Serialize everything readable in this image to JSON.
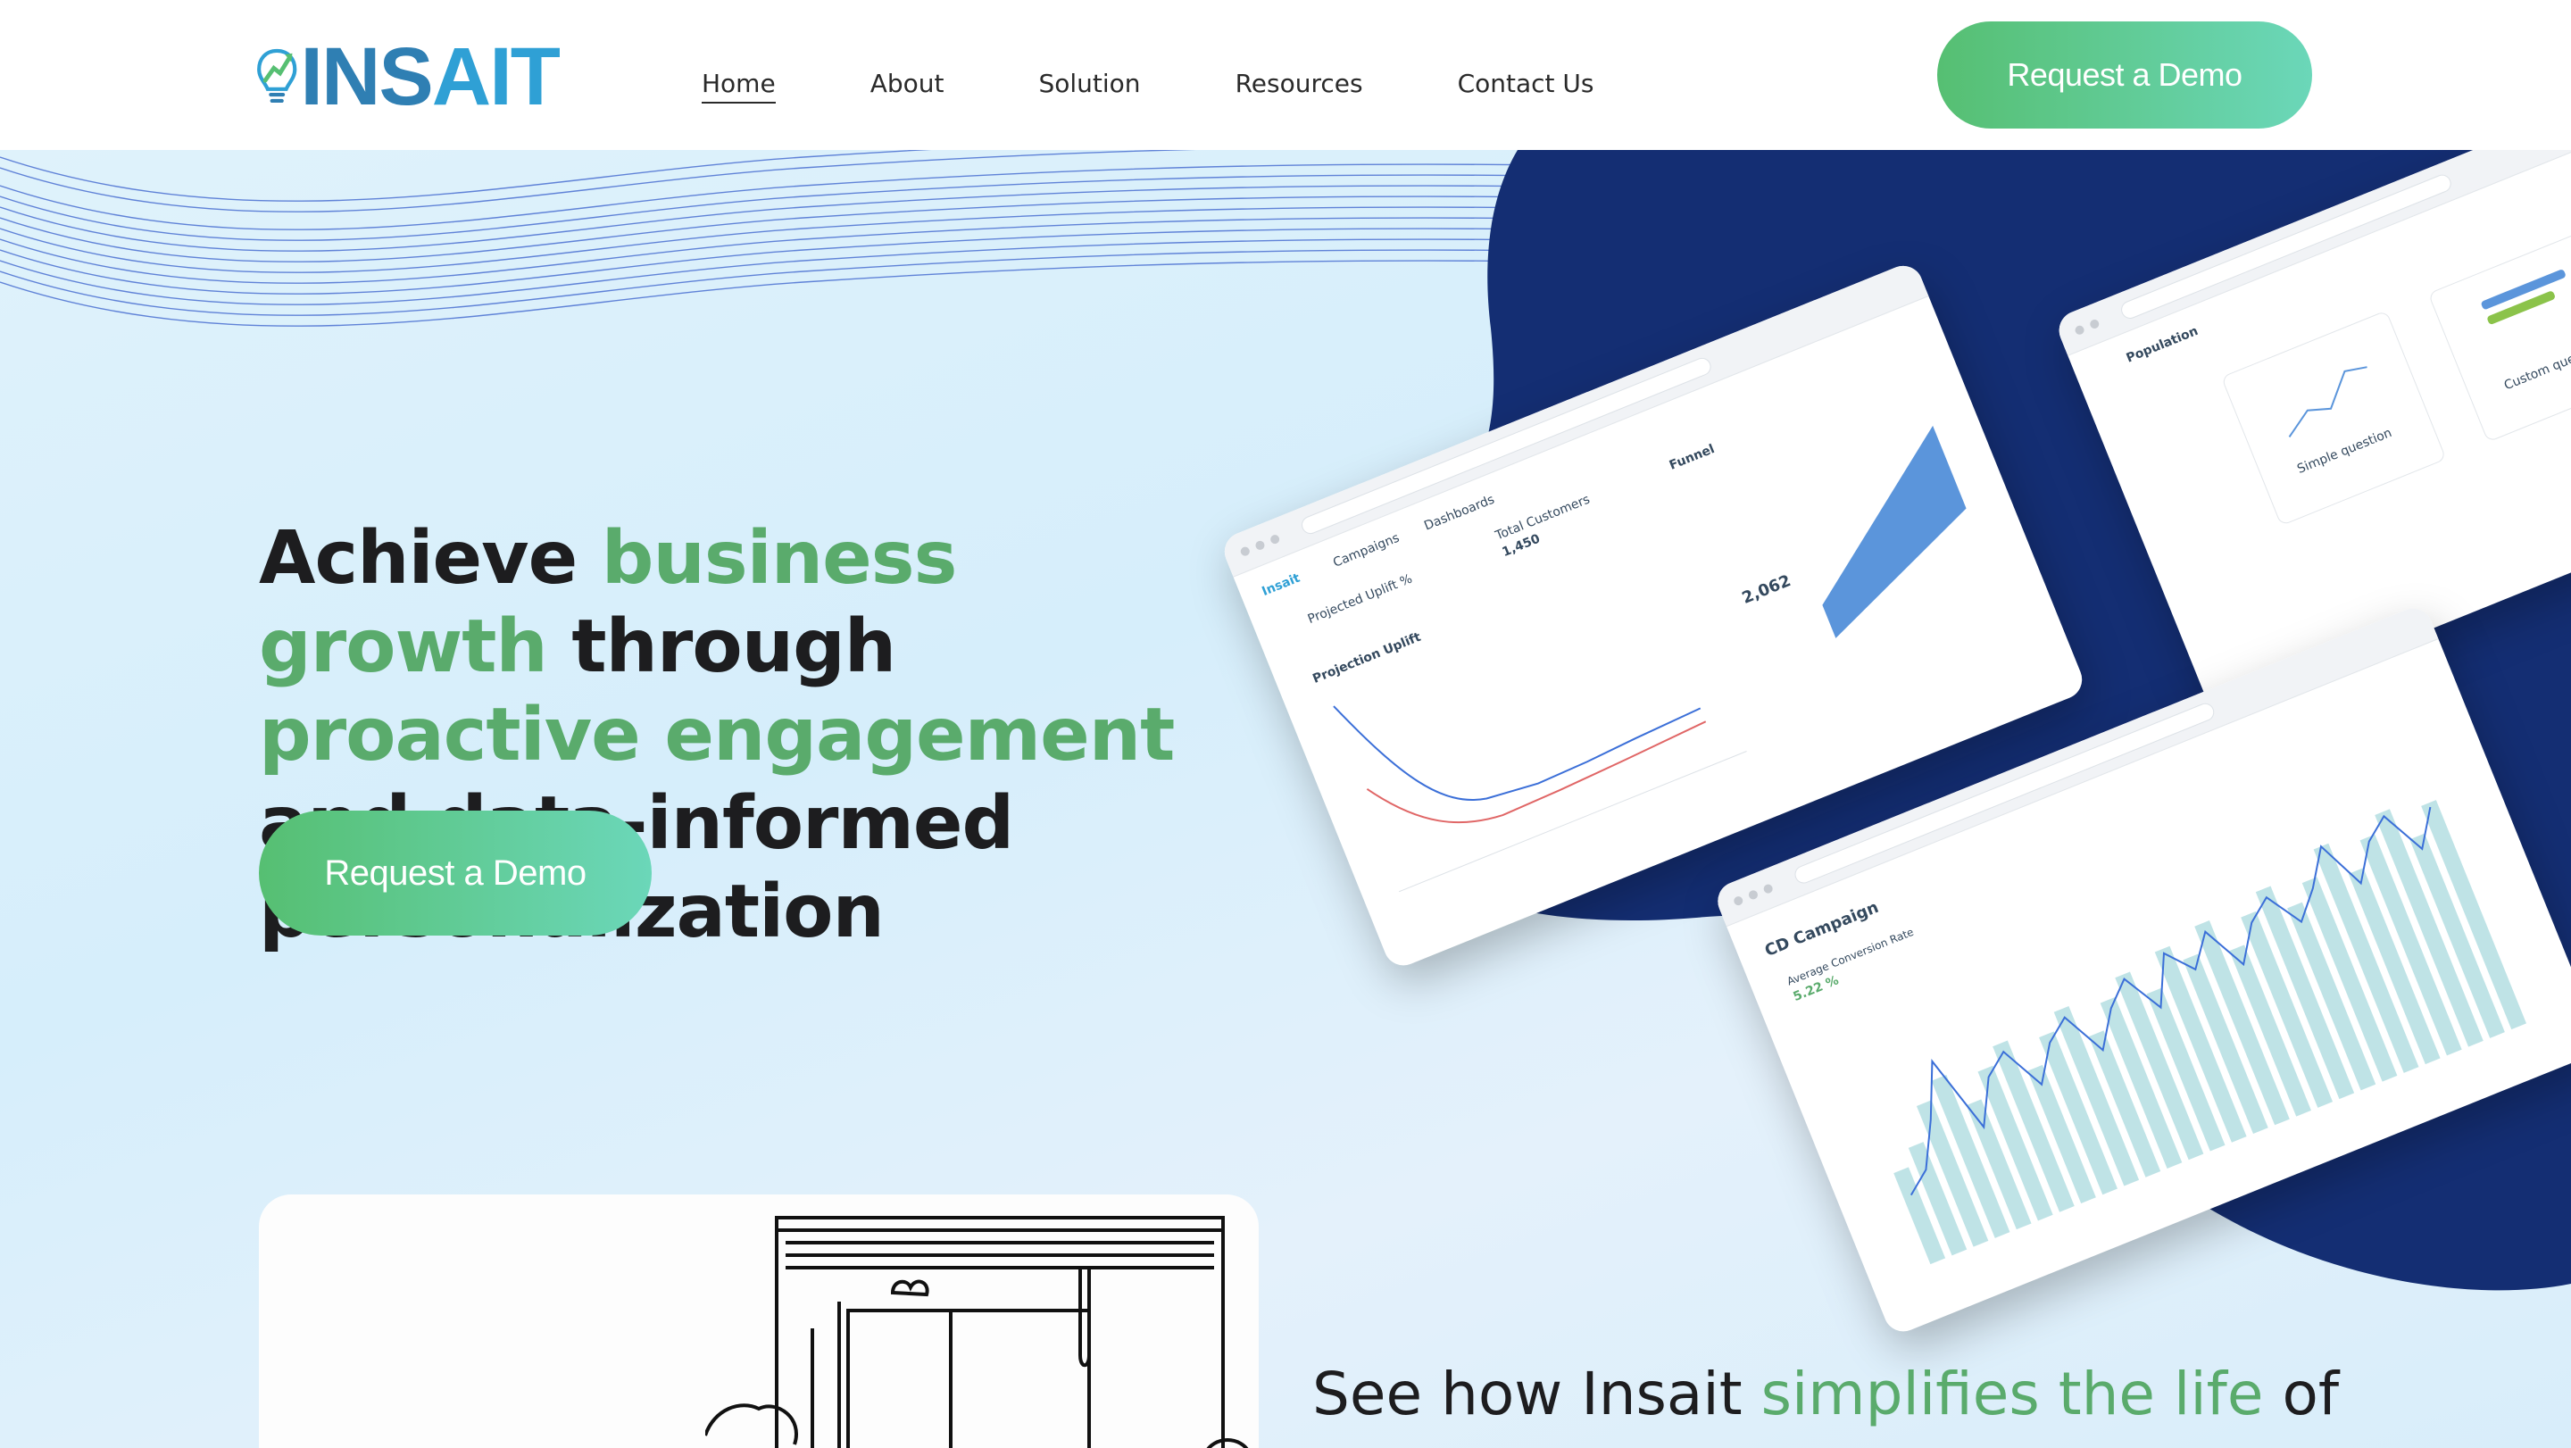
{
  "brand": {
    "logo_text_a": "INS",
    "logo_text_b": "AIT"
  },
  "nav": {
    "items": [
      {
        "label": "Home",
        "active": true
      },
      {
        "label": "About"
      },
      {
        "label": "Solution"
      },
      {
        "label": "Resources"
      },
      {
        "label": "Contact Us"
      }
    ],
    "cta_label": "Request a Demo"
  },
  "hero": {
    "headline": {
      "p1": "Achieve ",
      "g1": "business growth",
      "p2": " through ",
      "g2": "proactive engagement",
      "p3": " and data-informed personalization"
    },
    "cta_label": "Request a Demo"
  },
  "mockups": {
    "dashboard": {
      "brand": "Insait",
      "tab_campaigns": "Campaigns",
      "tab_dashboards": "Dashboards",
      "projected_uplift": "Projected Uplift %",
      "total_customers_label": "Total Customers",
      "total_customers_value": "1,450",
      "chart_title": "Projection Uplift",
      "funnel_title": "Funnel",
      "funnel_value": "2,062"
    },
    "population": {
      "title": "Population",
      "option1": "Simple question",
      "option2": "Custom question"
    },
    "campaign": {
      "title": "CD Campaign",
      "kpi_label": "Average Conversion Rate",
      "kpi_value": "5.22 %"
    }
  },
  "section2": {
    "p1": "See how Insait ",
    "g1": "simplifies the life",
    "p2": " of"
  },
  "colors": {
    "accent_green": "#5aab6c",
    "button_gradient_start": "#56bf72",
    "button_gradient_end": "#6bd7b9",
    "blob_navy": "#142e73",
    "logo_blue": "#2f7fb3"
  }
}
